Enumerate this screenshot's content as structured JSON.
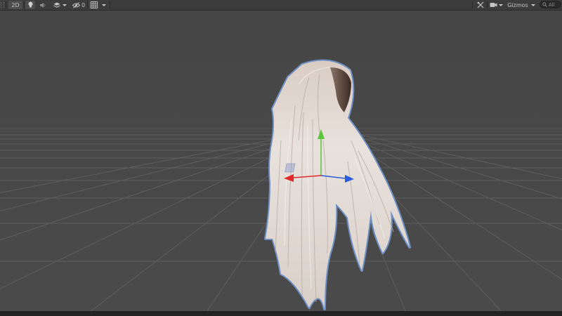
{
  "toolbar": {
    "mode_2d_label": "2D",
    "hidden_count": "0",
    "gizmos_label": "Gizmos",
    "search_label": "All"
  },
  "icons": {
    "lighting": "lightbulb-icon",
    "audio": "speaker-icon",
    "effects": "layers-icon",
    "visibility": "eye-slash-icon",
    "grid": "grid-icon",
    "tools": "tools-icon",
    "camera": "camera-icon",
    "search": "search-icon"
  },
  "colors": {
    "scene_background": "#464646",
    "grid_line": "#5c5c5c",
    "selection_outline": "#6d8fc4",
    "gizmo_x": "#e02a2a",
    "gizmo_y": "#5ac43d",
    "gizmo_z": "#2a5ce0"
  }
}
